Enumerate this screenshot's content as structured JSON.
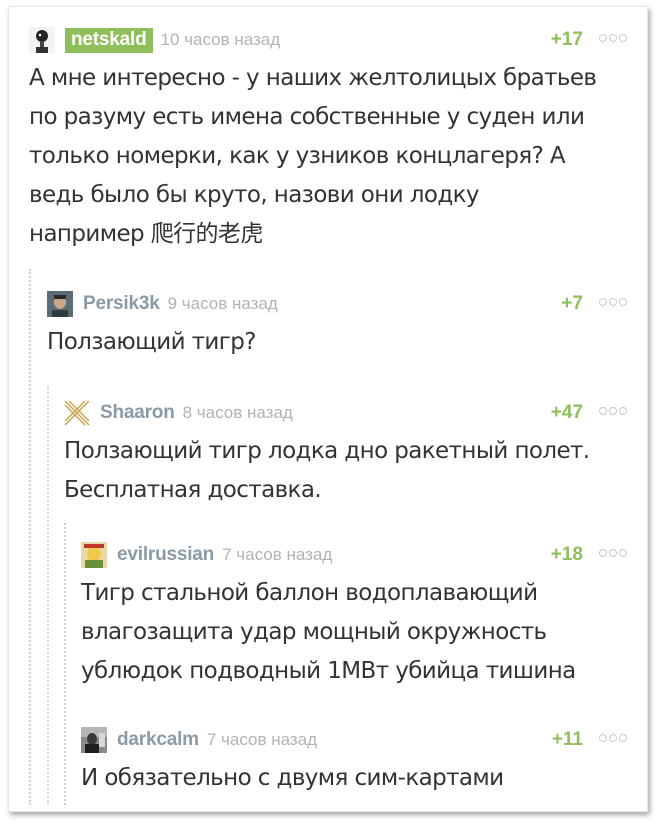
{
  "comments": [
    {
      "username": "netskald",
      "time": "10 часов назад",
      "rating": "+17",
      "text_lines": [
        "А мне интересно - у наших желтолицых братьев",
        "по разуму есть имена собственные у суден или",
        "только номерки, как у узников концлагеря? А",
        "ведь было бы круто, назови они лодку",
        "например 爬行的老虎"
      ]
    },
    {
      "username": "Persik3k",
      "time": "9 часов назад",
      "rating": "+7",
      "text_lines": [
        "Ползающий тигр?"
      ]
    },
    {
      "username": "Shaaron",
      "time": "8 часов назад",
      "rating": "+47",
      "text_lines": [
        "Ползающий тигр лодка дно ракетный полет.",
        "Бесплатная доставка."
      ]
    },
    {
      "username": "evilrussian",
      "time": "7 часов назад",
      "rating": "+18",
      "text_lines": [
        "Тигр стальной баллон водоплавающий",
        "влагозащита удар мощный окружность",
        "ублюдок подводный 1МВт убийца тишина"
      ]
    },
    {
      "username": "darkcalm",
      "time": "7 часов назад",
      "rating": "+11",
      "text_lines": [
        "И обязательно с двумя сим-картами"
      ]
    }
  ],
  "colors": {
    "username": "#8a9aa6",
    "highlight_bg": "#8fbf5a",
    "rating": "#8fbf5a",
    "time": "#b3b3b3",
    "text": "#333333"
  }
}
